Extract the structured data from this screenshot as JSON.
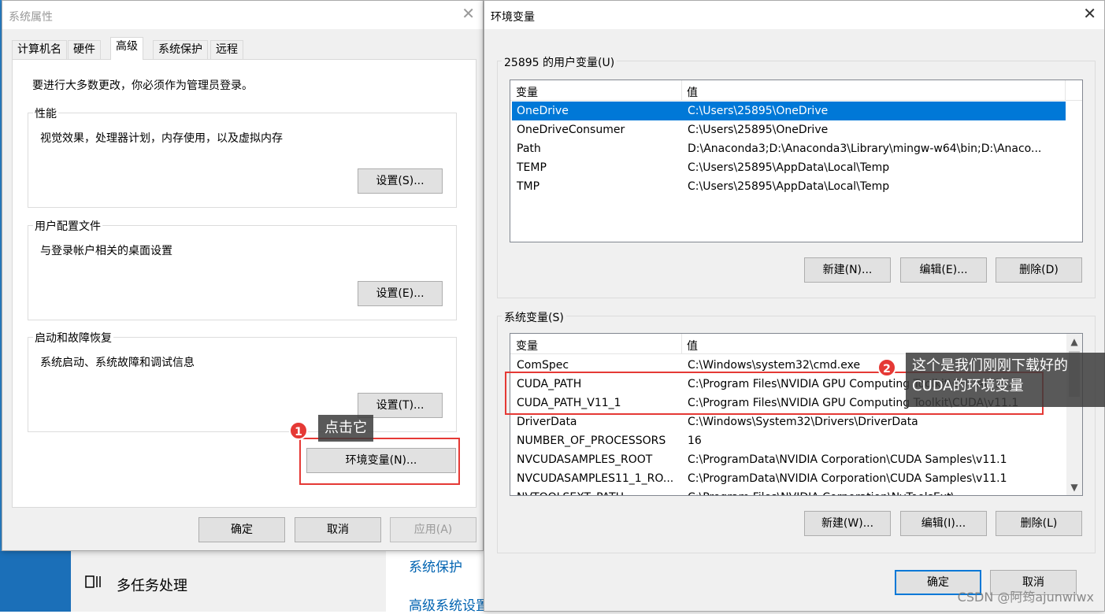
{
  "background": {
    "multitask_label": "多任务处理",
    "links": [
      "系统保护",
      "高级系统设置"
    ]
  },
  "sysprops": {
    "title": "系统属性",
    "tabs": [
      "计算机名",
      "硬件",
      "高级",
      "系统保护",
      "远程"
    ],
    "active_tab": "高级",
    "admin_note": "要进行大多数更改，你必须作为管理员登录。",
    "groups": [
      {
        "legend": "性能",
        "text": "视觉效果，处理器计划，内存使用，以及虚拟内存",
        "button": "设置(S)..."
      },
      {
        "legend": "用户配置文件",
        "text": "与登录帐户相关的桌面设置",
        "button": "设置(E)..."
      },
      {
        "legend": "启动和故障恢复",
        "text": "系统启动、系统故障和调试信息",
        "button": "设置(T)..."
      }
    ],
    "env_button": "环境变量(N)...",
    "ok": "确定",
    "cancel": "取消",
    "apply": "应用(A)"
  },
  "envvars": {
    "title": "环境变量",
    "user_section": "25895 的用户变量(U)",
    "columns": [
      "变量",
      "值"
    ],
    "user_rows": [
      {
        "name": "OneDrive",
        "value": "C:\\Users\\25895\\OneDrive"
      },
      {
        "name": "OneDriveConsumer",
        "value": "C:\\Users\\25895\\OneDrive"
      },
      {
        "name": "Path",
        "value": "D:\\Anaconda3;D:\\Anaconda3\\Library\\mingw-w64\\bin;D:\\Anaco..."
      },
      {
        "name": "TEMP",
        "value": "C:\\Users\\25895\\AppData\\Local\\Temp"
      },
      {
        "name": "TMP",
        "value": "C:\\Users\\25895\\AppData\\Local\\Temp"
      }
    ],
    "user_buttons": [
      "新建(N)...",
      "编辑(E)...",
      "删除(D)"
    ],
    "system_section": "系统变量(S)",
    "system_rows": [
      {
        "name": "ComSpec",
        "value": "C:\\Windows\\system32\\cmd.exe"
      },
      {
        "name": "CUDA_PATH",
        "value": "C:\\Program Files\\NVIDIA GPU Computing Toolkit\\CUDA\\v11.1"
      },
      {
        "name": "CUDA_PATH_V11_1",
        "value": "C:\\Program Files\\NVIDIA GPU Computing Toolkit\\CUDA\\v11.1"
      },
      {
        "name": "DriverData",
        "value": "C:\\Windows\\System32\\Drivers\\DriverData"
      },
      {
        "name": "NUMBER_OF_PROCESSORS",
        "value": "16"
      },
      {
        "name": "NVCUDASAMPLES_ROOT",
        "value": "C:\\ProgramData\\NVIDIA Corporation\\CUDA Samples\\v11.1"
      },
      {
        "name": "NVCUDASAMPLES11_1_RO...",
        "value": "C:\\ProgramData\\NVIDIA Corporation\\CUDA Samples\\v11.1"
      },
      {
        "name": "NVTOOLSEXT_PATH",
        "value": "C:\\Program Files\\NVIDIA Corporation\\NvToolsExt\\"
      }
    ],
    "system_buttons": [
      "新建(W)...",
      "编辑(I)...",
      "删除(L)"
    ],
    "ok": "确定",
    "cancel": "取消"
  },
  "annotations": {
    "badge1": "1",
    "callout1": "点击它",
    "badge2": "2",
    "callout2_line1": "这个是我们刚刚下载好的",
    "callout2_line2": "CUDA的环境变量"
  },
  "watermark": "CSDN @阿筠ajunwiwx",
  "colors": {
    "selection": "#0078d7",
    "annotation_red": "#e53935",
    "desktop_blue": "#2b89d6"
  }
}
